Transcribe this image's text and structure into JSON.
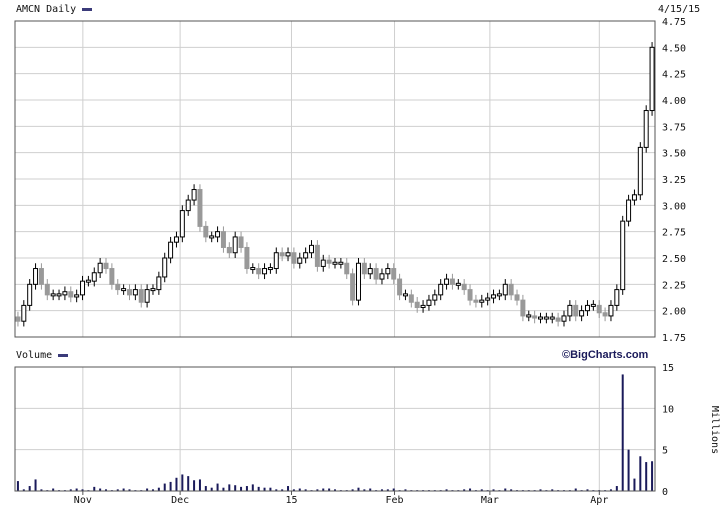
{
  "header": {
    "title": "AMCN Daily",
    "date": "4/15/15",
    "volume_title": "Volume",
    "brand": "©BigCharts.com",
    "volume_unit": "Millions"
  },
  "colors": {
    "up": "#000000",
    "down": "#999999",
    "volume": "#1a1a5a",
    "legend": "#3b3b7a"
  },
  "chart_data": [
    {
      "type": "candlestick",
      "title": "AMCN Daily",
      "ylim": [
        1.75,
        4.75
      ],
      "yticks": [
        "1.75",
        "2.00",
        "2.25",
        "2.50",
        "2.75",
        "3.00",
        "3.25",
        "3.50",
        "3.75",
        "4.00",
        "4.25",
        "4.50",
        "4.75"
      ],
      "xticks": [
        "Nov",
        "Dec",
        "15",
        "Feb",
        "Mar",
        "Apr"
      ],
      "close": [
        1.9,
        2.05,
        2.25,
        2.4,
        2.25,
        2.15,
        2.15,
        2.15,
        2.18,
        2.13,
        2.15,
        2.28,
        2.28,
        2.36,
        2.45,
        2.4,
        2.25,
        2.2,
        2.2,
        2.15,
        2.2,
        2.08,
        2.2,
        2.2,
        2.32,
        2.5,
        2.65,
        2.7,
        2.95,
        3.05,
        3.15,
        2.8,
        2.7,
        2.7,
        2.75,
        2.6,
        2.55,
        2.7,
        2.6,
        2.4,
        2.4,
        2.35,
        2.4,
        2.4,
        2.55,
        2.52,
        2.55,
        2.45,
        2.5,
        2.55,
        2.62,
        2.42,
        2.48,
        2.45,
        2.45,
        2.45,
        2.35,
        2.1,
        2.45,
        2.35,
        2.4,
        2.3,
        2.35,
        2.4,
        2.3,
        2.15,
        2.15,
        2.08,
        2.03,
        2.05,
        2.1,
        2.15,
        2.25,
        2.3,
        2.25,
        2.25,
        2.2,
        2.1,
        2.08,
        2.1,
        2.12,
        2.15,
        2.15,
        2.25,
        2.15,
        2.1,
        1.95,
        1.95,
        1.93,
        1.93,
        1.93,
        1.93,
        1.9,
        1.95,
        2.05,
        1.95,
        2.0,
        2.05,
        2.05,
        1.98,
        1.95,
        2.05,
        2.2,
        2.85,
        3.05,
        3.1,
        3.55,
        3.9,
        4.5
      ],
      "volume_millions": [
        1.2,
        0.2,
        0.6,
        1.4,
        0.2,
        0.1,
        0.3,
        0.1,
        0.1,
        0.2,
        0.3,
        0.2,
        0.1,
        0.5,
        0.3,
        0.2,
        0.1,
        0.2,
        0.3,
        0.2,
        0.1,
        0.1,
        0.3,
        0.2,
        0.4,
        0.9,
        1.1,
        1.6,
        2.0,
        1.8,
        1.3,
        1.4,
        0.6,
        0.4,
        0.9,
        0.4,
        0.8,
        0.7,
        0.5,
        0.6,
        0.8,
        0.5,
        0.4,
        0.4,
        0.2,
        0.2,
        0.6,
        0.2,
        0.3,
        0.2,
        0.1,
        0.2,
        0.3,
        0.3,
        0.2,
        0.1,
        0.1,
        0.2,
        0.4,
        0.2,
        0.3,
        0.1,
        0.2,
        0.2,
        0.3,
        0.1,
        0.2,
        0.1,
        0.1,
        0.1,
        0.1,
        0.1,
        0.1,
        0.2,
        0.1,
        0.1,
        0.2,
        0.3,
        0.1,
        0.2,
        0.1,
        0.2,
        0.1,
        0.3,
        0.2,
        0.1,
        0.1,
        0.1,
        0.1,
        0.2,
        0.1,
        0.2,
        0.1,
        0.1,
        0.1,
        0.3,
        0.1,
        0.2,
        0.1,
        0.1,
        0.1,
        0.2,
        0.6,
        14.1,
        5.0,
        1.5,
        4.2,
        3.5,
        3.6
      ]
    },
    {
      "type": "bar",
      "title": "Volume",
      "ylabel": "Millions",
      "ylim": [
        0,
        15
      ],
      "yticks": [
        "0",
        "5",
        "10",
        "15"
      ]
    }
  ]
}
